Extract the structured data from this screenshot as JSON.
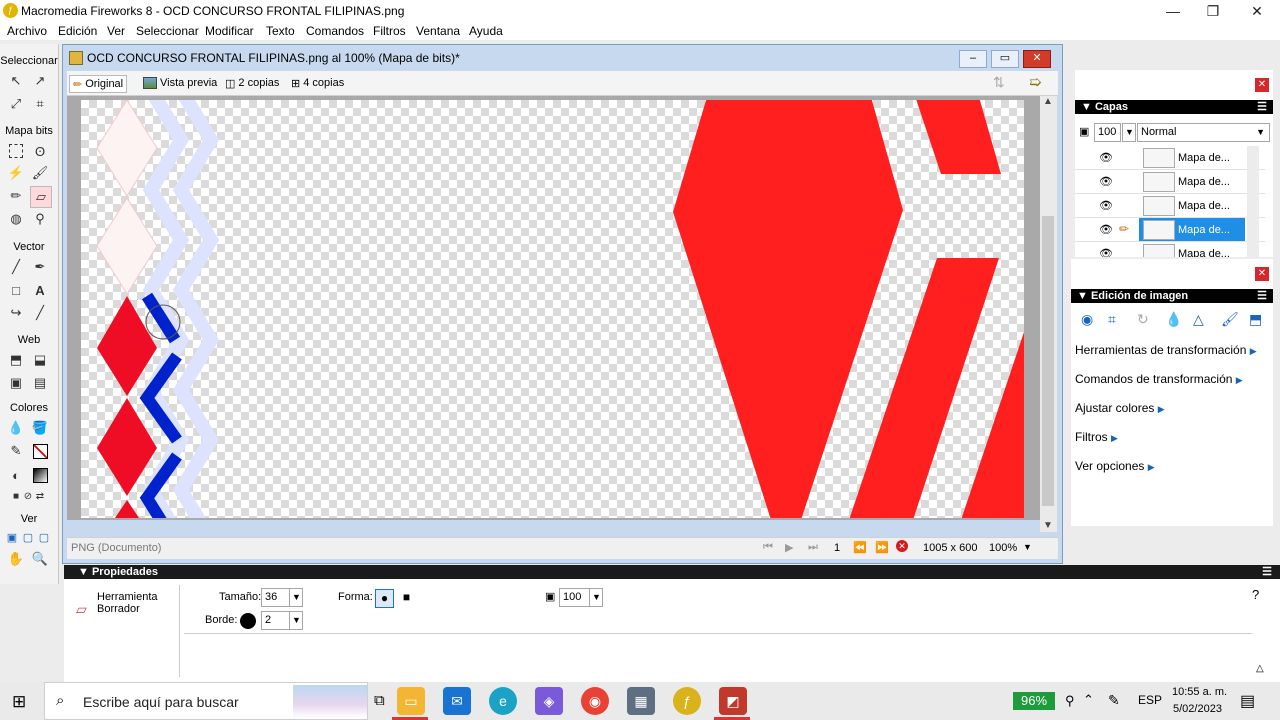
{
  "app": {
    "title": "Macromedia Fireworks 8 - OCD CONCURSO FRONTAL FILIPINAS.png",
    "window_controls": {
      "minimize": "—",
      "maximize": "❐",
      "close": "✕"
    }
  },
  "menubar": [
    "Archivo",
    "Edición",
    "Ver",
    "Seleccionar",
    "Modificar",
    "Texto",
    "Comandos",
    "Filtros",
    "Ventana",
    "Ayuda"
  ],
  "tools": {
    "sections": [
      "Seleccionar",
      "Mapa bits",
      "Vector",
      "Web",
      "Colores",
      "Ver"
    ]
  },
  "document": {
    "title": "OCD CONCURSO FRONTAL FILIPINAS.png al 100% (Mapa de bits)*",
    "tabs": [
      "Original",
      "Vista previa",
      "2 copias",
      "4 copias"
    ],
    "status_left": "PNG (Documento)",
    "frame": "1",
    "size": "1005 x 600",
    "zoom": "100%"
  },
  "colors": {
    "red": "#ff1f1f",
    "blue": "#0022cc",
    "light_blue": "#dde2ff",
    "selection": "#1f8ee6"
  },
  "layers_panel": {
    "title": "Capas",
    "opacity": "100",
    "blend": "Normal",
    "layers": [
      "Mapa de...",
      "Mapa de...",
      "Mapa de...",
      "Mapa de...",
      "Mapa de..."
    ],
    "selected_index": 3
  },
  "image_edit_panel": {
    "title": "Edición de imagen",
    "items": [
      "Herramientas de transformación",
      "Comandos de transformación",
      "Ajustar colores",
      "Filtros",
      "Ver opciones"
    ]
  },
  "properties": {
    "title": "Propiedades",
    "tool_name": "Herramienta Borrador",
    "size_label": "Tamaño:",
    "size_value": "36",
    "shape_label": "Forma:",
    "edge_label": "Borde:",
    "edge_value": "2",
    "opacity_value": "100"
  },
  "taskbar": {
    "search_placeholder": "Escribe aquí para buscar",
    "battery": "96%",
    "language": "ESP",
    "time": "10:55 a. m.",
    "date": "5/02/2023"
  }
}
